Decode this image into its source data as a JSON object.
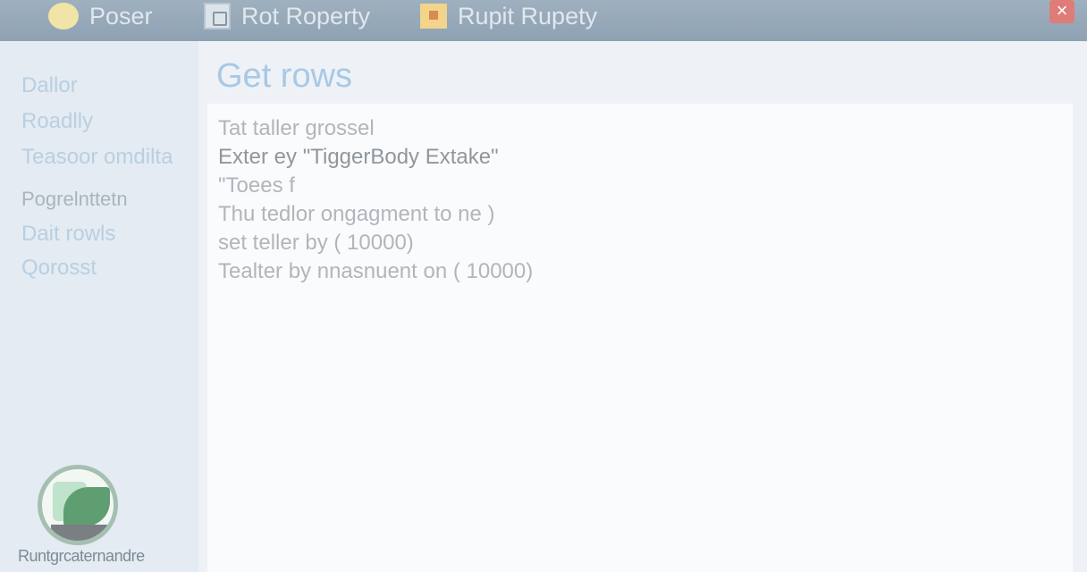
{
  "toolbar": {
    "items": [
      {
        "label": "Poser",
        "icon": "circle-icon"
      },
      {
        "label": "Rot Roperty",
        "icon": "document-icon"
      },
      {
        "label": "Rupit Rupety",
        "icon": "orange-square-icon"
      }
    ],
    "close_label": "×"
  },
  "sidebar": {
    "items": [
      {
        "label": "Dallor"
      },
      {
        "label": "Roadlly"
      },
      {
        "label": "Teasoor omdilta"
      },
      {
        "label": "Pogrelnttetn"
      },
      {
        "label": "Dait rowls"
      },
      {
        "label": "Qorosst"
      }
    ],
    "logo_text": "Runtgrcaternandre"
  },
  "main": {
    "title": "Get rows",
    "lines": [
      "Tat taller grossel",
      "Exter ey \"TiggerBody Extake\"",
      "\"Toees f",
      "Thu tedlor ongagment to ne )",
      "set teller by ( 10000)",
      "Tealter by nnasnuent on ( 10000)"
    ]
  },
  "colors": {
    "toolbar": "#93a6b6",
    "title": "#a8c8e6",
    "close": "#df7c78"
  }
}
